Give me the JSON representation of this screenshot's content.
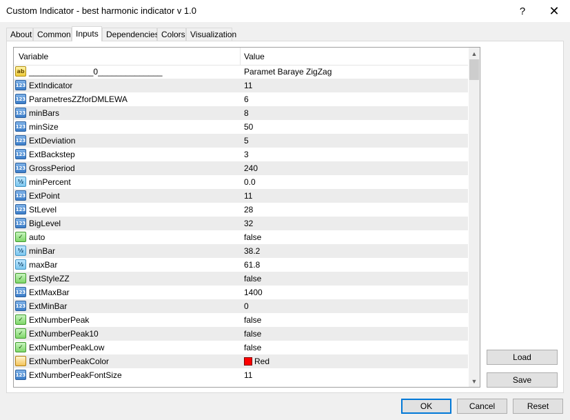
{
  "window": {
    "title": "Custom Indicator - best harmonic indicator v 1.0",
    "help_label": "?",
    "close_label": "✕"
  },
  "tabs": [
    {
      "label": "About",
      "active": false
    },
    {
      "label": "Common",
      "active": false
    },
    {
      "label": "Inputs",
      "active": true
    },
    {
      "label": "Dependencies",
      "active": false
    },
    {
      "label": "Colors",
      "active": false
    },
    {
      "label": "Visualization",
      "active": false
    }
  ],
  "inputs": {
    "columns": {
      "variable": "Variable",
      "value": "Value"
    },
    "rows": [
      {
        "type": "str",
        "icon": "string-type-icon",
        "badge": "ab",
        "name": "______________0______________",
        "value": "Paramet Baraye ZigZag"
      },
      {
        "type": "int",
        "icon": "integer-type-icon",
        "badge": "123",
        "name": "ExtIndicator",
        "value": "11"
      },
      {
        "type": "int",
        "icon": "integer-type-icon",
        "badge": "123",
        "name": "ParametresZZforDMLEWA",
        "value": "6"
      },
      {
        "type": "int",
        "icon": "integer-type-icon",
        "badge": "123",
        "name": "minBars",
        "value": "8"
      },
      {
        "type": "int",
        "icon": "integer-type-icon",
        "badge": "123",
        "name": "minSize",
        "value": "50"
      },
      {
        "type": "int",
        "icon": "integer-type-icon",
        "badge": "123",
        "name": "ExtDeviation",
        "value": "5"
      },
      {
        "type": "int",
        "icon": "integer-type-icon",
        "badge": "123",
        "name": "ExtBackstep",
        "value": "3"
      },
      {
        "type": "int",
        "icon": "integer-type-icon",
        "badge": "123",
        "name": "GrossPeriod",
        "value": "240"
      },
      {
        "type": "dbl",
        "icon": "double-type-icon",
        "badge": "½",
        "name": "minPercent",
        "value": "0.0"
      },
      {
        "type": "int",
        "icon": "integer-type-icon",
        "badge": "123",
        "name": "ExtPoint",
        "value": "11"
      },
      {
        "type": "int",
        "icon": "integer-type-icon",
        "badge": "123",
        "name": "StLevel",
        "value": "28"
      },
      {
        "type": "int",
        "icon": "integer-type-icon",
        "badge": "123",
        "name": "BigLevel",
        "value": "32"
      },
      {
        "type": "bool",
        "icon": "bool-type-icon",
        "badge": "✓",
        "name": "auto",
        "value": "false"
      },
      {
        "type": "dbl",
        "icon": "double-type-icon",
        "badge": "½",
        "name": "minBar",
        "value": "38.2"
      },
      {
        "type": "dbl",
        "icon": "double-type-icon",
        "badge": "½",
        "name": "maxBar",
        "value": "61.8"
      },
      {
        "type": "bool",
        "icon": "bool-type-icon",
        "badge": "✓",
        "name": "ExtStyleZZ",
        "value": "false"
      },
      {
        "type": "int",
        "icon": "integer-type-icon",
        "badge": "123",
        "name": "ExtMaxBar",
        "value": "1400"
      },
      {
        "type": "int",
        "icon": "integer-type-icon",
        "badge": "123",
        "name": "ExtMinBar",
        "value": "0"
      },
      {
        "type": "bool",
        "icon": "bool-type-icon",
        "badge": "✓",
        "name": "ExtNumberPeak",
        "value": "false"
      },
      {
        "type": "bool",
        "icon": "bool-type-icon",
        "badge": "✓",
        "name": "ExtNumberPeak10",
        "value": "false"
      },
      {
        "type": "bool",
        "icon": "bool-type-icon",
        "badge": "✓",
        "name": "ExtNumberPeakLow",
        "value": "false"
      },
      {
        "type": "color",
        "icon": "color-type-icon",
        "badge": "",
        "name": "ExtNumberPeakColor",
        "value": "Red",
        "swatch": "#ff0000"
      },
      {
        "type": "int",
        "icon": "integer-type-icon",
        "badge": "123",
        "name": "ExtNumberPeakFontSize",
        "value": "11"
      }
    ]
  },
  "side_buttons": {
    "load": "Load",
    "save": "Save"
  },
  "footer_buttons": {
    "ok": "OK",
    "cancel": "Cancel",
    "reset": "Reset"
  },
  "scroll": {
    "up_icon": "▲",
    "down_icon": "▼"
  }
}
